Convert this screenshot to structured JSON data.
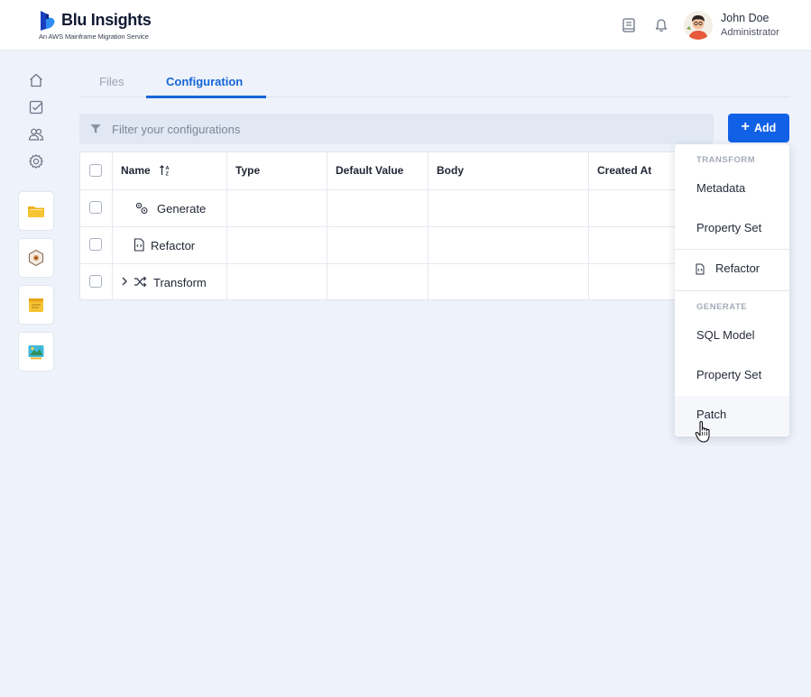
{
  "app": {
    "title": "Blu Insights",
    "subtitle": "An AWS Mainframe Migration Service"
  },
  "user": {
    "name": "John Doe",
    "role": "Administrator"
  },
  "tabs": [
    {
      "label": "Files",
      "active": false
    },
    {
      "label": "Configuration",
      "active": true
    }
  ],
  "filter": {
    "placeholder": "Filter your configurations"
  },
  "add_button": {
    "label": "Add"
  },
  "table": {
    "columns": [
      "Name",
      "Type",
      "Default Value",
      "Body",
      "Created At"
    ],
    "rows": [
      {
        "name": "Generate"
      },
      {
        "name": "Refactor"
      },
      {
        "name": "Transform"
      }
    ]
  },
  "menu": {
    "section_transform": "TRANSFORM",
    "item_metadata": "Metadata",
    "item_property_set_transform": "Property Set",
    "item_refactor": "Refactor",
    "section_generate": "GENERATE",
    "item_sql_model": "SQL Model",
    "item_property_set_generate": "Property Set",
    "item_patch": "Patch"
  },
  "colors": {
    "accent": "#1161e6",
    "background": "#eef2fa"
  }
}
